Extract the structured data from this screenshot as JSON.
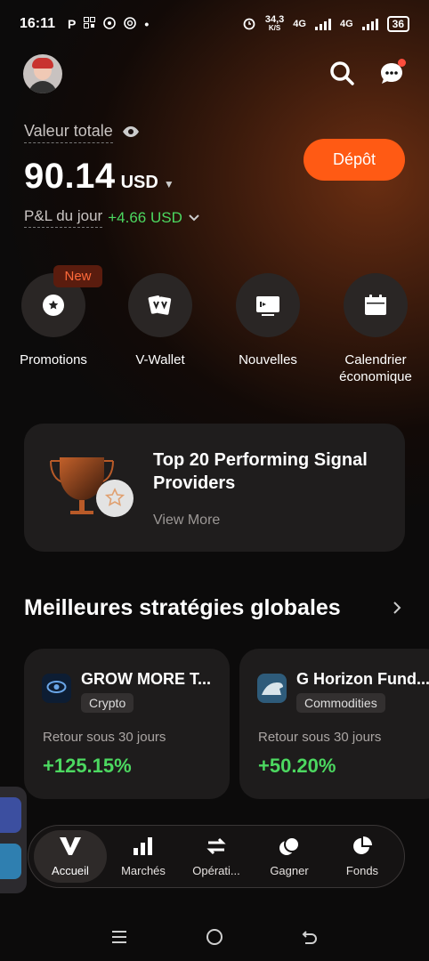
{
  "status_bar": {
    "time": "16:11",
    "app_icons": [
      "P",
      "qr-icon",
      "whatsapp-icon",
      "chrome-icon",
      "•"
    ],
    "net_speed_value": "34,3",
    "net_speed_unit": "K/S",
    "network1": "4G",
    "network2": "4G",
    "battery": "36"
  },
  "header": {
    "total_label": "Valeur totale",
    "balance_value": "90.14",
    "balance_currency": "USD",
    "pnl_label": "P&L du jour",
    "pnl_value": "+4.66 USD",
    "deposit_label": "Dépôt",
    "accent_color": "#ff5a14",
    "positive_color": "#4cd860"
  },
  "quick_actions": [
    {
      "label": "Promotions",
      "icon": "star-badge-icon",
      "badge": "New"
    },
    {
      "label": "V-Wallet",
      "icon": "wallet-cards-icon"
    },
    {
      "label": "Nouvelles",
      "icon": "news-icon"
    },
    {
      "label": "Calendrier économique",
      "icon": "calendar-icon"
    }
  ],
  "banner": {
    "title": "Top 20 Performing Signal Providers",
    "link": "View More",
    "icon": "trophy-icon"
  },
  "strategies": {
    "title": "Meilleures stratégies globales",
    "cards": [
      {
        "name": "GROW MORE T...",
        "tag": "Crypto",
        "return_label": "Retour sous 30 jours",
        "return_value": "+125.15%"
      },
      {
        "name": "G Horizon Fund...",
        "tag": "Commodities",
        "return_label": "Retour sous 30 jours",
        "return_value": "+50.20%"
      }
    ]
  },
  "tabs": [
    {
      "label": "Accueil",
      "icon": "v-logo-icon",
      "active": true
    },
    {
      "label": "Marchés",
      "icon": "bar-chart-icon"
    },
    {
      "label": "Opérati...",
      "icon": "swap-arrows-icon"
    },
    {
      "label": "Gagner",
      "icon": "coins-icon"
    },
    {
      "label": "Fonds",
      "icon": "pie-chart-icon"
    }
  ]
}
